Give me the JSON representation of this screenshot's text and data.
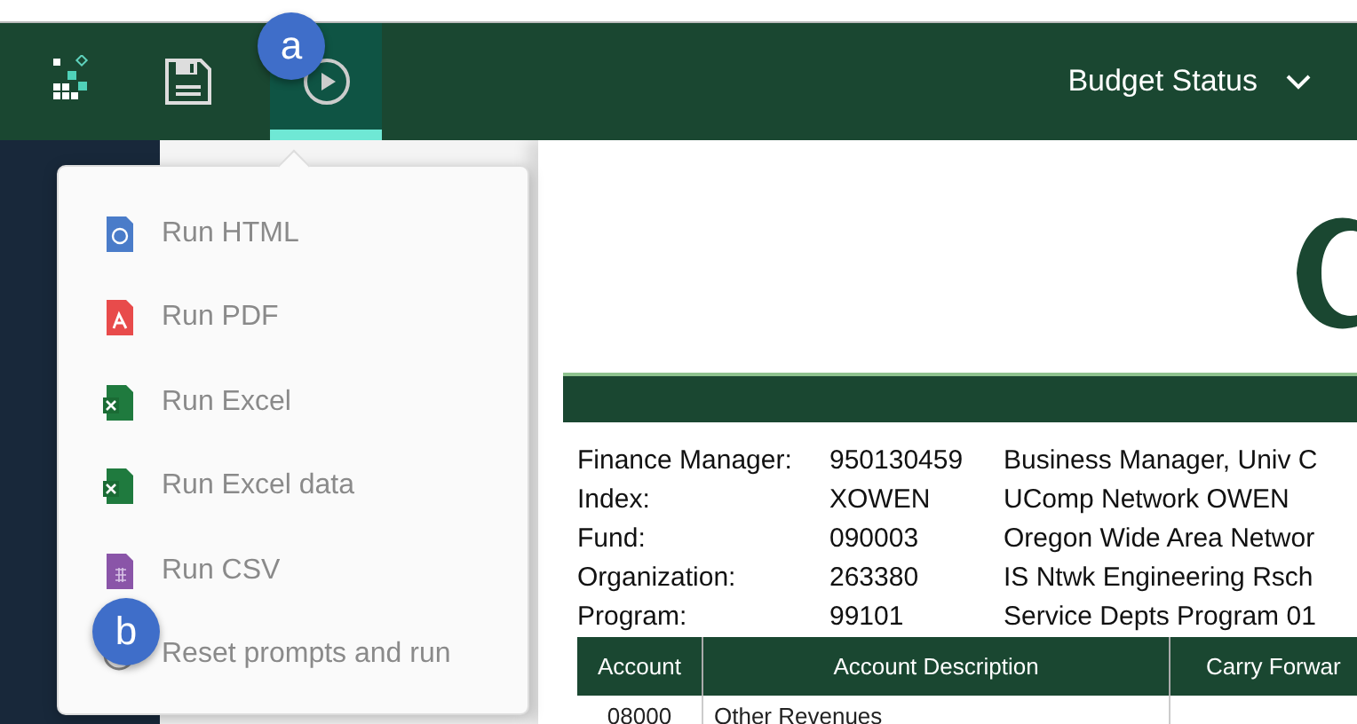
{
  "toolbar": {
    "run_button": {
      "selected": true
    },
    "report_title": "Budget Status"
  },
  "run_menu": {
    "items": [
      {
        "kind": "html",
        "label": "Run HTML"
      },
      {
        "kind": "pdf",
        "label": "Run PDF"
      },
      {
        "kind": "excel",
        "label": "Run Excel"
      },
      {
        "kind": "excel",
        "label": "Run Excel data"
      },
      {
        "kind": "csv",
        "label": "Run CSV"
      },
      {
        "kind": "reset",
        "label": "Reset prompts and run"
      }
    ]
  },
  "callouts": [
    "a",
    "b"
  ],
  "report": {
    "info": [
      {
        "label": "Finance Manager:",
        "value": "950130459",
        "description": "Business Manager, Univ C"
      },
      {
        "label": "Index:",
        "value": "XOWEN",
        "description": "UComp Network OWEN"
      },
      {
        "label": "Fund:",
        "value": "090003",
        "description": "Oregon Wide Area Networ"
      },
      {
        "label": "Organization:",
        "value": "263380",
        "description": "IS Ntwk Engineering Rsch"
      },
      {
        "label": "Program:",
        "value": "99101",
        "description": "Service Depts Program 01"
      }
    ],
    "table": {
      "columns": [
        "Account",
        "Account Description",
        "Carry Forwar"
      ],
      "rows": [
        [
          "08000",
          "Other Revenues",
          ""
        ]
      ]
    }
  }
}
